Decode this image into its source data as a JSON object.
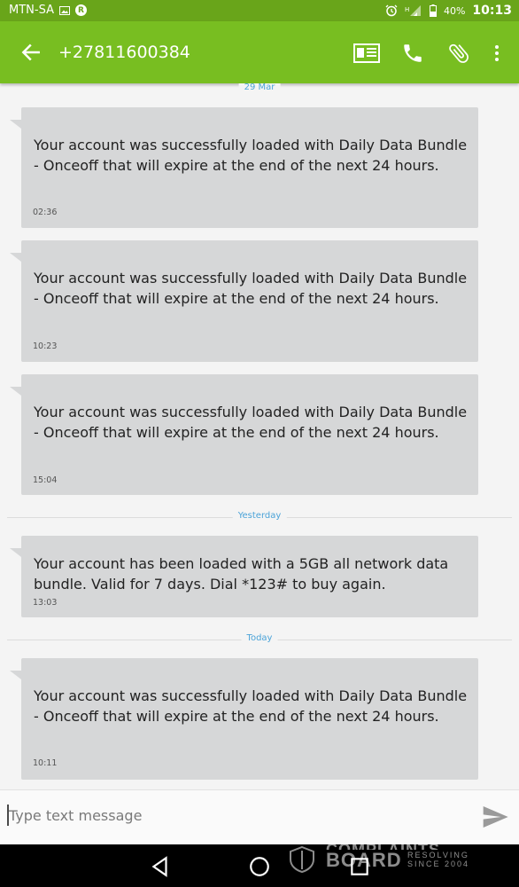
{
  "status_bar": {
    "carrier": "MTN-SA",
    "battery": "40%",
    "time": "10:13",
    "icons": [
      "image-icon",
      "r-icon",
      "alarm-icon",
      "signal-icon",
      "battery-icon"
    ]
  },
  "toolbar": {
    "title": "+27811600384",
    "icons": [
      "back-arrow-icon",
      "contact-card-icon",
      "phone-icon",
      "attachment-icon",
      "overflow-menu-icon"
    ]
  },
  "dates": {
    "first": "29 Mar",
    "yesterday": "Yesterday",
    "today": "Today"
  },
  "messages": [
    {
      "text": "Your account was successfully loaded with Daily Data Bundle - Onceoff that will expire at the end of the next 24 hours.",
      "time": "02:36"
    },
    {
      "text": "Your account was successfully loaded with Daily Data Bundle - Onceoff that will expire at the end of the next 24 hours.",
      "time": "10:23"
    },
    {
      "text": "Your account was successfully loaded with Daily Data Bundle - Onceoff that will expire at the end of the next 24 hours.",
      "time": "15:04"
    },
    {
      "text": "Your account has been loaded with a 5GB all network data bundle. Valid for 7 days. Dial *123# to buy again.",
      "time": "13:03"
    },
    {
      "text": "Your account was successfully loaded with Daily Data Bundle - Onceoff that will expire at the end of the next 24 hours.",
      "time": "10:11"
    }
  ],
  "compose": {
    "placeholder": "Type text message"
  },
  "watermark": {
    "top": "COMPLAINTS",
    "main": "BOARD",
    "side_line1": "RESOLVING",
    "side_line2": "SINCE 2004"
  },
  "colors": {
    "toolbar": "#78be21",
    "status_bar": "#69a51a",
    "bubble": "#d6d7d8",
    "date_label": "#4ba3d8"
  }
}
